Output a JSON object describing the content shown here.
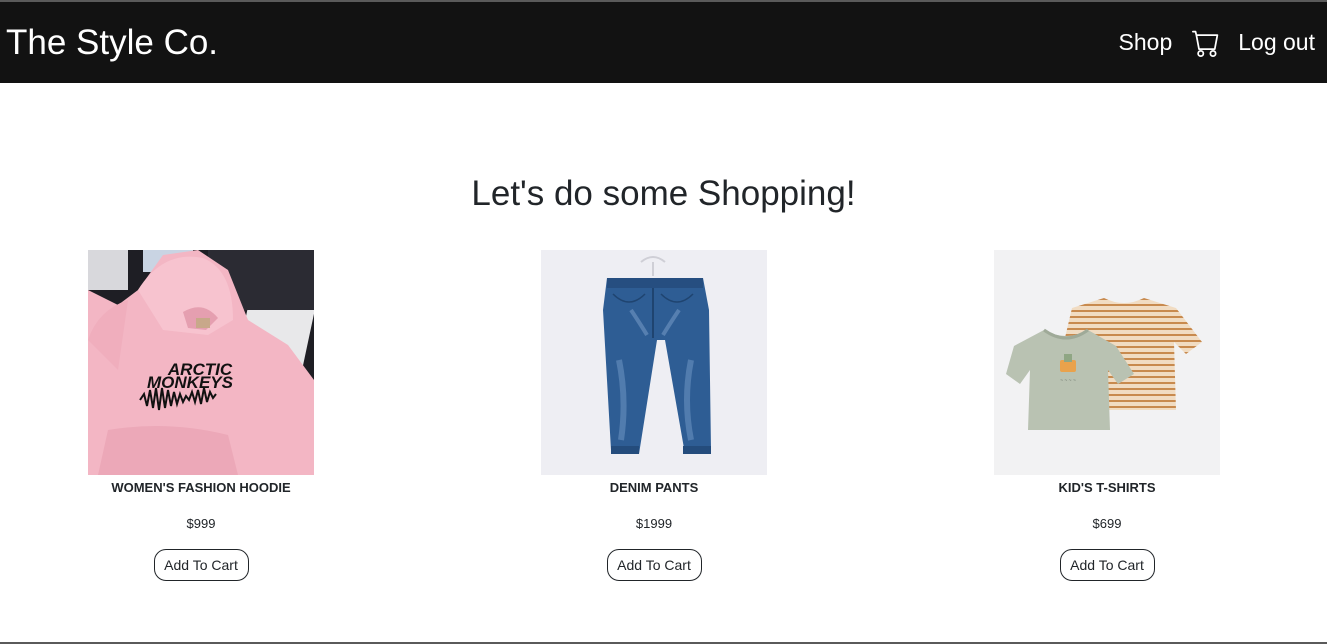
{
  "navbar": {
    "brand": "The Style Co.",
    "shop_label": "Shop",
    "cart_icon": "cart-icon",
    "logout_label": "Log out",
    "background": "#121212"
  },
  "main": {
    "heading": "Let's do some Shopping!"
  },
  "products": [
    {
      "name": "WOMEN'S FASHION HOODIE",
      "price": "$999",
      "button_label": "Add To Cart",
      "image": "pink-hoodie-image"
    },
    {
      "name": "DENIM PANTS",
      "price": "$1999",
      "button_label": "Add To Cart",
      "image": "denim-jeans-image"
    },
    {
      "name": "KID'S T-SHIRTS",
      "price": "$699",
      "button_label": "Add To Cart",
      "image": "kids-tshirts-image"
    }
  ]
}
